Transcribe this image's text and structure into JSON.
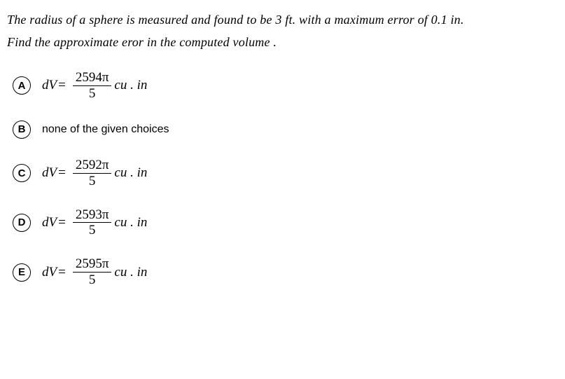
{
  "question": {
    "line1": "The radius of a sphere is measured and found to be 3 ft. with a maximum error of 0.1 in.",
    "line2": "Find the approximate eror in the computed volume ."
  },
  "choices": {
    "a": {
      "letter": "A",
      "lhs": "dV",
      "eq": "=",
      "num": "2594π",
      "den": "5",
      "unit": "cu . in"
    },
    "b": {
      "letter": "B",
      "text": "none of the given choices"
    },
    "c": {
      "letter": "C",
      "lhs": "dV",
      "eq": "=",
      "num": "2592π",
      "den": "5",
      "unit": "cu . in"
    },
    "d": {
      "letter": "D",
      "lhs": "dV",
      "eq": "=",
      "num": "2593π",
      "den": "5",
      "unit": "cu . in"
    },
    "e": {
      "letter": "E",
      "lhs": "dV",
      "eq": "=",
      "num": "2595π",
      "den": "5",
      "unit": "cu . in"
    }
  }
}
